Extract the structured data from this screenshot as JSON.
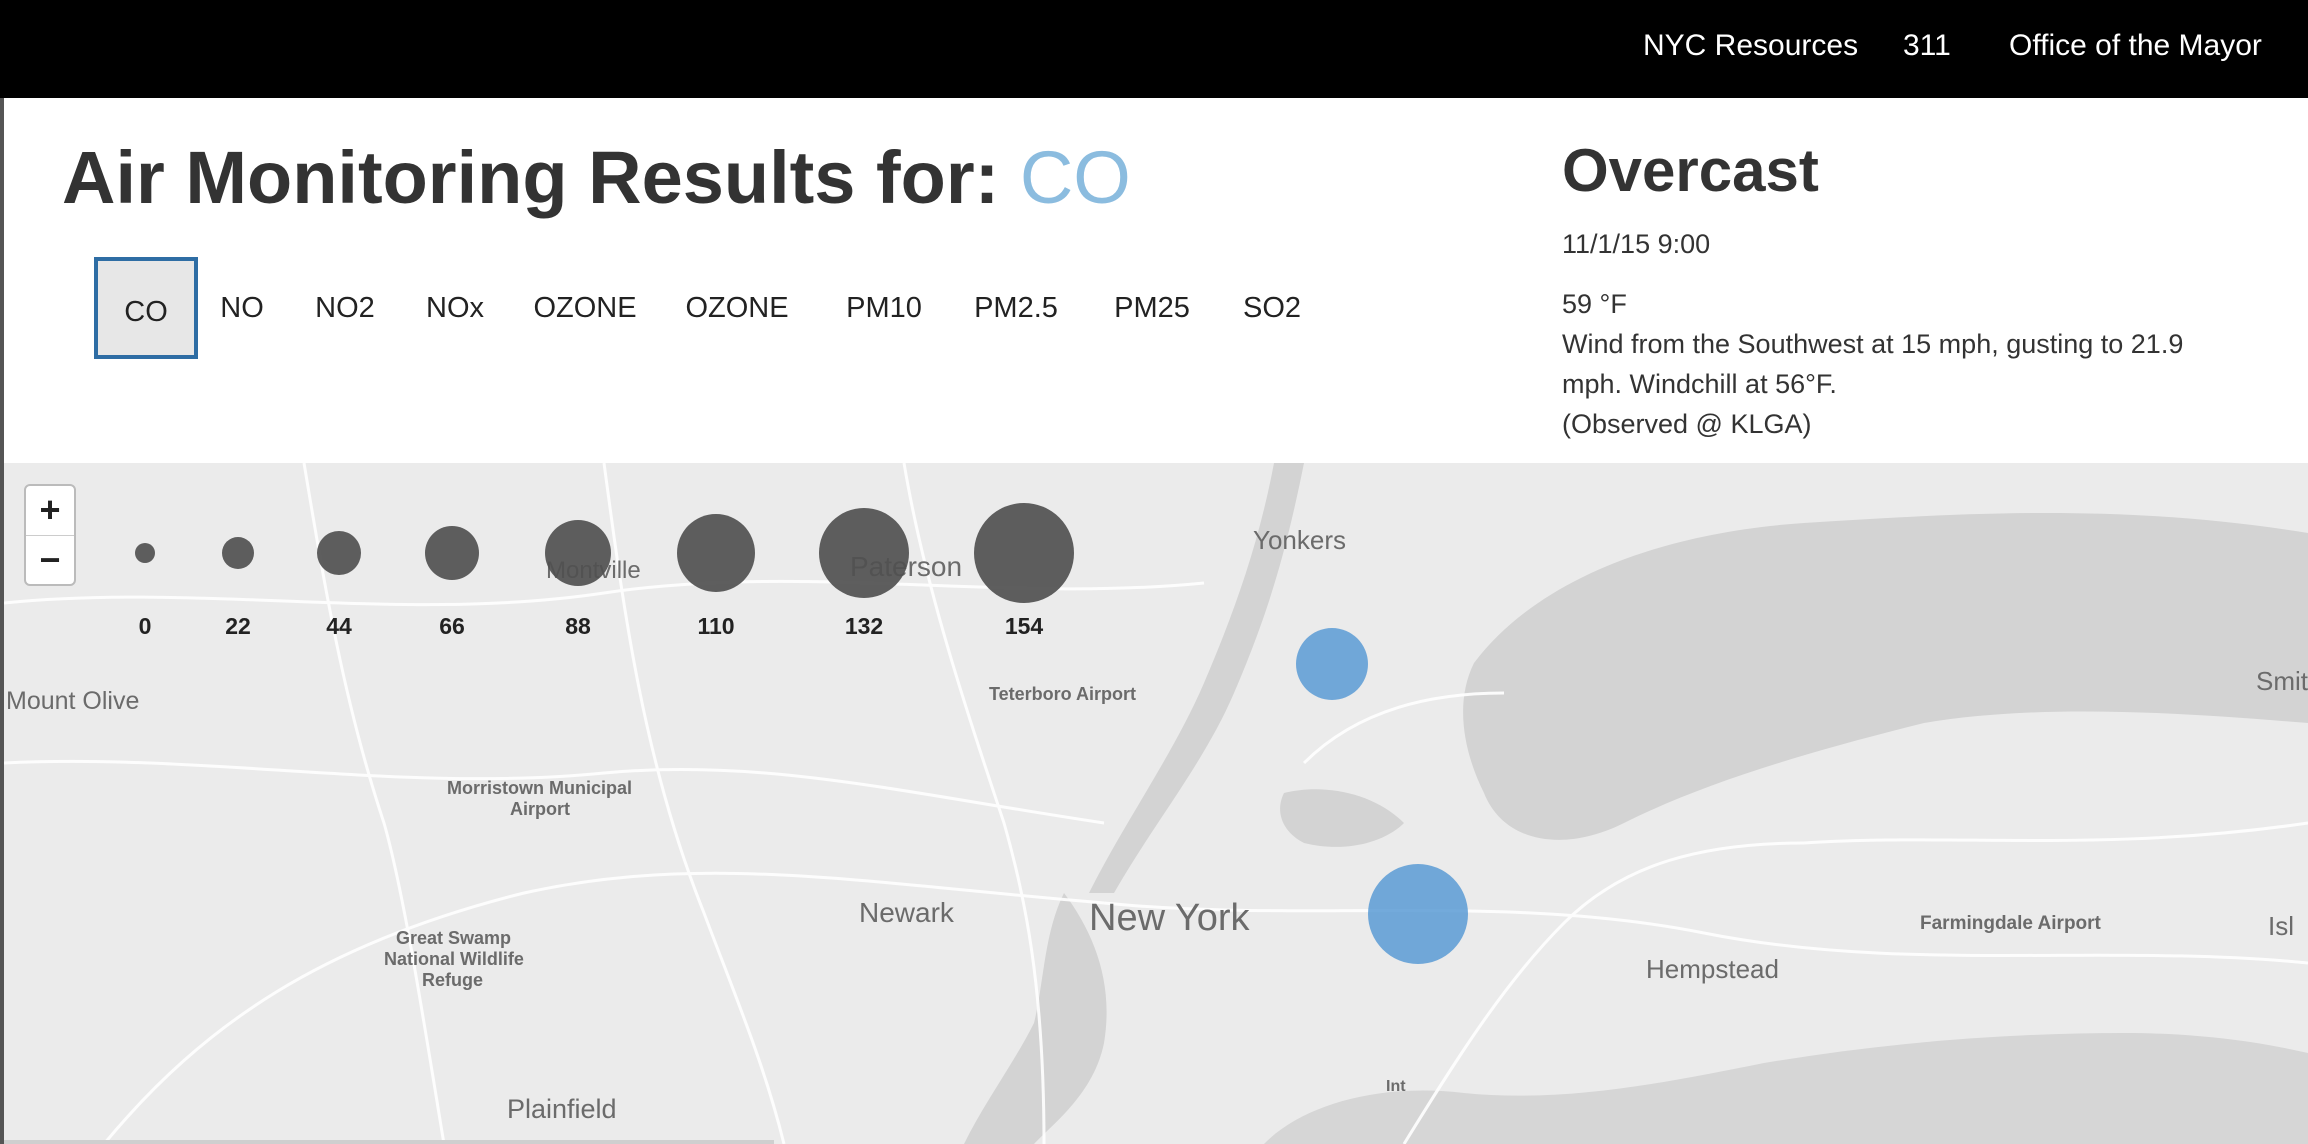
{
  "nav": {
    "links": [
      "NYC Resources",
      "311",
      "Office of the Mayor"
    ]
  },
  "header": {
    "title_prefix": "Air Monitoring Results for:",
    "selected_pollutant": "CO",
    "accent_color": "#8bbcdf"
  },
  "tabs": {
    "items": [
      "CO",
      "NO",
      "NO2",
      "NOx",
      "OZONE",
      "OZONE",
      "PM10",
      "PM2.5",
      "PM25",
      "SO2"
    ],
    "active_index": 0
  },
  "weather": {
    "condition": "Overcast",
    "datetime": "11/1/15 9:00",
    "temperature": "59 °F",
    "wind_line1": "Wind from the Southwest at 15 mph, gusting to 21.9",
    "wind_line2": "mph. Windchill at 56°F.",
    "observed": "(Observed @ KLGA)"
  },
  "map": {
    "zoom_in": "+",
    "zoom_out": "−",
    "legend": {
      "values": [
        "0",
        "22",
        "44",
        "66",
        "88",
        "110",
        "132",
        "154"
      ]
    },
    "places": [
      "Mount Olive",
      "Montville",
      "Paterson",
      "Yonkers",
      "Teterboro Airport",
      "Morristown Municipal",
      "Airport",
      "Great Swamp",
      "National Wildlife",
      "Refuge",
      "Newark",
      "New York",
      "Hempstead",
      "Farmingdale Airport",
      "Plainfield",
      "Smit",
      "Isl",
      "Int"
    ],
    "marker_color": "#5b9bd5",
    "legend_color": "#505050"
  }
}
